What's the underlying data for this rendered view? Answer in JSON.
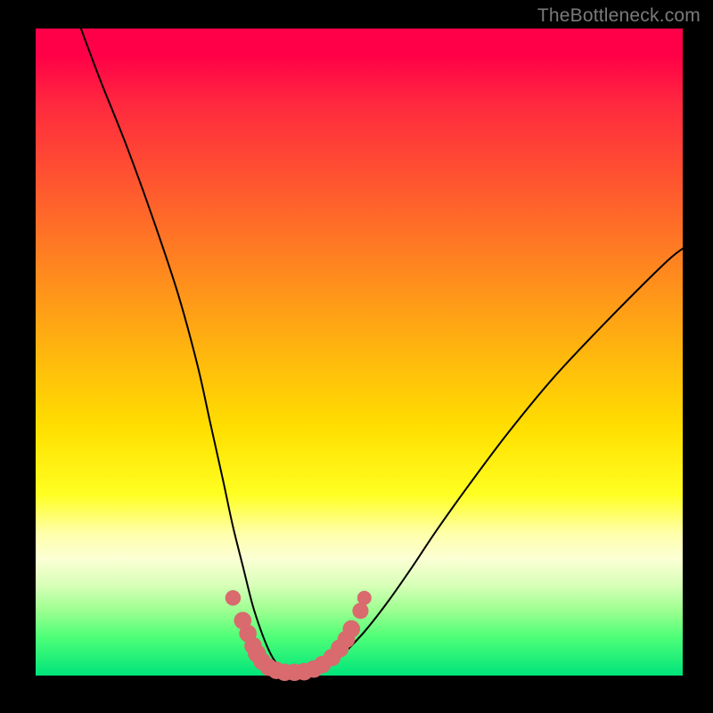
{
  "watermark": {
    "text": "TheBottleneck.com"
  },
  "chart_data": {
    "type": "line",
    "title": "",
    "xlabel": "",
    "ylabel": "",
    "xlim": [
      0,
      100
    ],
    "ylim": [
      0,
      100
    ],
    "grid": false,
    "legend": false,
    "series": [
      {
        "name": "bottleneck-curve",
        "x": [
          7,
          10,
          14,
          18,
          22,
          25,
          27,
          29,
          30.5,
          32,
          33.5,
          34.8,
          36,
          37,
          38,
          39.5,
          41,
          42.5,
          44,
          46,
          48,
          51,
          54.5,
          58,
          62,
          67,
          73,
          80,
          88,
          97,
          100
        ],
        "y": [
          100,
          92,
          82,
          71,
          59,
          48,
          39,
          30,
          23,
          17,
          11,
          7,
          4,
          2.2,
          1.2,
          0.6,
          0.5,
          0.6,
          1.0,
          2.0,
          3.8,
          7,
          11.5,
          16.5,
          22.5,
          29.5,
          37.5,
          46,
          54.5,
          63.5,
          66
        ]
      }
    ],
    "markers": [
      {
        "x": 30.5,
        "y": 12.0,
        "r": 1.2
      },
      {
        "x": 32.0,
        "y": 8.5,
        "r": 1.35
      },
      {
        "x": 32.8,
        "y": 6.5,
        "r": 1.35
      },
      {
        "x": 33.6,
        "y": 4.6,
        "r": 1.35
      },
      {
        "x": 34.2,
        "y": 3.4,
        "r": 1.4
      },
      {
        "x": 35.0,
        "y": 2.2,
        "r": 1.35
      },
      {
        "x": 36.0,
        "y": 1.3,
        "r": 1.35
      },
      {
        "x": 37.2,
        "y": 0.8,
        "r": 1.35
      },
      {
        "x": 38.5,
        "y": 0.5,
        "r": 1.35
      },
      {
        "x": 40.0,
        "y": 0.5,
        "r": 1.35
      },
      {
        "x": 41.5,
        "y": 0.6,
        "r": 1.35
      },
      {
        "x": 43.0,
        "y": 1.0,
        "r": 1.35
      },
      {
        "x": 44.3,
        "y": 1.7,
        "r": 1.35
      },
      {
        "x": 45.8,
        "y": 2.8,
        "r": 1.35
      },
      {
        "x": 47.0,
        "y": 4.2,
        "r": 1.4
      },
      {
        "x": 48.0,
        "y": 5.6,
        "r": 1.35
      },
      {
        "x": 48.8,
        "y": 7.2,
        "r": 1.35
      },
      {
        "x": 50.2,
        "y": 10.0,
        "r": 1.25
      },
      {
        "x": 50.8,
        "y": 12.0,
        "r": 1.1
      }
    ],
    "marker_color": "#d96a6e",
    "curve_color": "#000000",
    "background_gradient": [
      {
        "stop": 0,
        "color": "#ff0048"
      },
      {
        "stop": 50,
        "color": "#ffb60e"
      },
      {
        "stop": 75,
        "color": "#ffff44"
      },
      {
        "stop": 100,
        "color": "#00e47a"
      }
    ]
  }
}
